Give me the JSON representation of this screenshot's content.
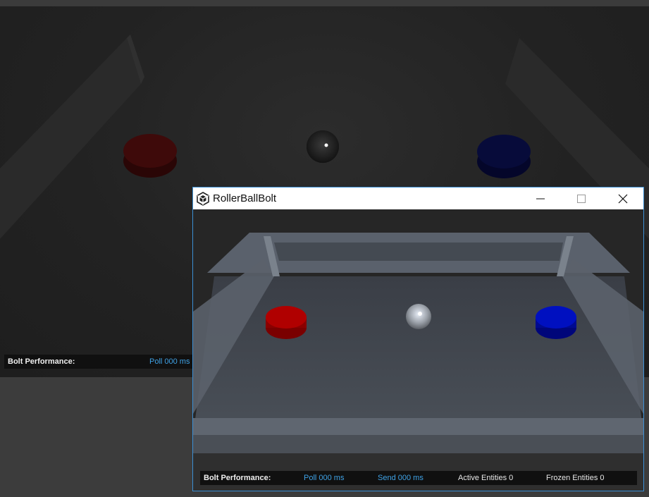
{
  "background_game": {
    "perf": {
      "title": "Bolt Performance:",
      "poll": "Poll 000 ms"
    }
  },
  "window": {
    "title": "RollerBallBolt",
    "controls": [
      "minimize-icon",
      "maximize-icon",
      "close-icon"
    ],
    "perf": {
      "title": "Bolt Performance:",
      "poll": "Poll 000 ms",
      "send": "Send 000 ms",
      "active": "Active Entities 0",
      "frozen": "Frozen Entities 0"
    }
  },
  "colors": {
    "accent_blue_text": "#3fa2e6",
    "window_border": "#3c8fd4",
    "red_pad": "#b00000",
    "blue_pad": "#0010c0"
  }
}
